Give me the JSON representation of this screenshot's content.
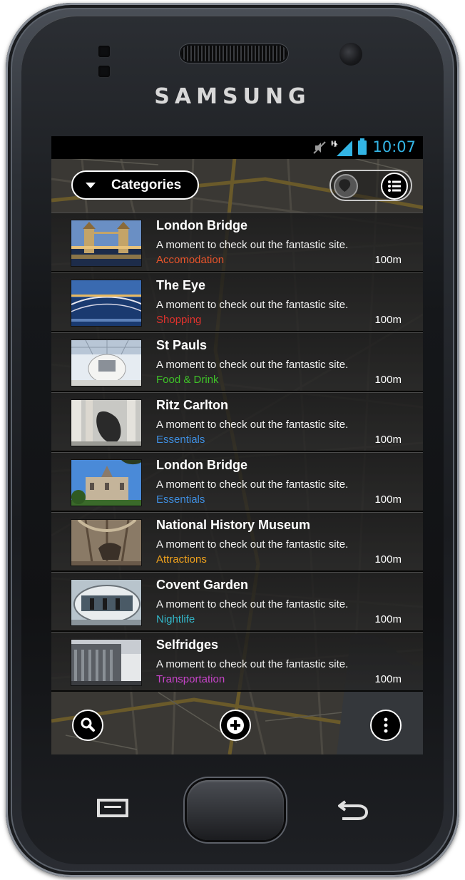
{
  "brand": "SAMSUNG",
  "statusbar": {
    "time": "10:07",
    "icons": [
      "mute-icon",
      "signal-icon",
      "battery-icon"
    ],
    "accent": "#33b5e5"
  },
  "toolbar": {
    "categories_label": "Categories",
    "map_view_icon": "map-pin-icon",
    "list_view_icon": "list-icon"
  },
  "pois": [
    {
      "title": "London Bridge",
      "description": "A moment to check out the fantastic site.",
      "category": "Accomodation",
      "category_color": "#e8542b",
      "distance": "100m",
      "thumb": "tower-bridge"
    },
    {
      "title": "The Eye",
      "description": "A moment to check out the fantastic site.",
      "category": "Shopping",
      "category_color": "#e0322d",
      "distance": "100m",
      "thumb": "river-night"
    },
    {
      "title": "St Pauls",
      "description": "A moment to check out the fantastic site.",
      "category": "Food & Drink",
      "category_color": "#3ec128",
      "distance": "100m",
      "thumb": "white-atrium"
    },
    {
      "title": "Ritz Carlton",
      "description": "A moment to check out the fantastic site.",
      "category": "Essentials",
      "category_color": "#3f8ee0",
      "distance": "100m",
      "thumb": "sculpture"
    },
    {
      "title": "London Bridge",
      "description": "A moment to check out the fantastic site.",
      "category": "Essentials",
      "category_color": "#3f8ee0",
      "distance": "100m",
      "thumb": "museum-facade"
    },
    {
      "title": "National History Museum",
      "description": "A moment to check out the fantastic site.",
      "category": "Attractions",
      "category_color": "#f0a21d",
      "distance": "100m",
      "thumb": "museum-hall"
    },
    {
      "title": "Covent Garden",
      "description": "A moment to check out the fantastic site.",
      "category": "Nightlife",
      "category_color": "#33b6c8",
      "distance": "100m",
      "thumb": "eye-capsule"
    },
    {
      "title": "Selfridges",
      "description": "A moment to check out the fantastic site.",
      "category": "Transportation",
      "category_color": "#c644c8",
      "distance": "100m",
      "thumb": "store-building"
    }
  ],
  "bottom_bar": {
    "search_icon": "search-icon",
    "add_icon": "add-icon",
    "more_icon": "more-vertical-icon"
  },
  "hardware_keys": [
    "menu-key-icon",
    "home-key",
    "back-key-icon"
  ]
}
